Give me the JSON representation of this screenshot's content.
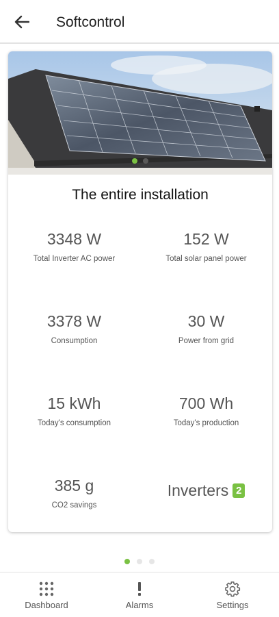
{
  "app": {
    "title": "Softcontrol"
  },
  "card": {
    "title": "The entire installation",
    "stats": [
      {
        "value": "3348 W",
        "label": "Total Inverter AC power"
      },
      {
        "value": "152 W",
        "label": "Total solar panel power"
      },
      {
        "value": "3378 W",
        "label": "Consumption"
      },
      {
        "value": "30 W",
        "label": "Power from grid"
      },
      {
        "value": "15 kWh",
        "label": "Today's consumption"
      },
      {
        "value": "700 Wh",
        "label": "Today's production"
      },
      {
        "value": "385 g",
        "label": "CO2 savings"
      }
    ],
    "inverters": {
      "label": "Inverters",
      "count": "2"
    }
  },
  "nav": {
    "items": [
      {
        "label": "Dashboard",
        "icon": "grid-dots-icon"
      },
      {
        "label": "Alarms",
        "icon": "exclamation-icon"
      },
      {
        "label": "Settings",
        "icon": "gear-icon"
      }
    ]
  },
  "colors": {
    "accent": "#7ac143",
    "text_muted": "#555555"
  }
}
